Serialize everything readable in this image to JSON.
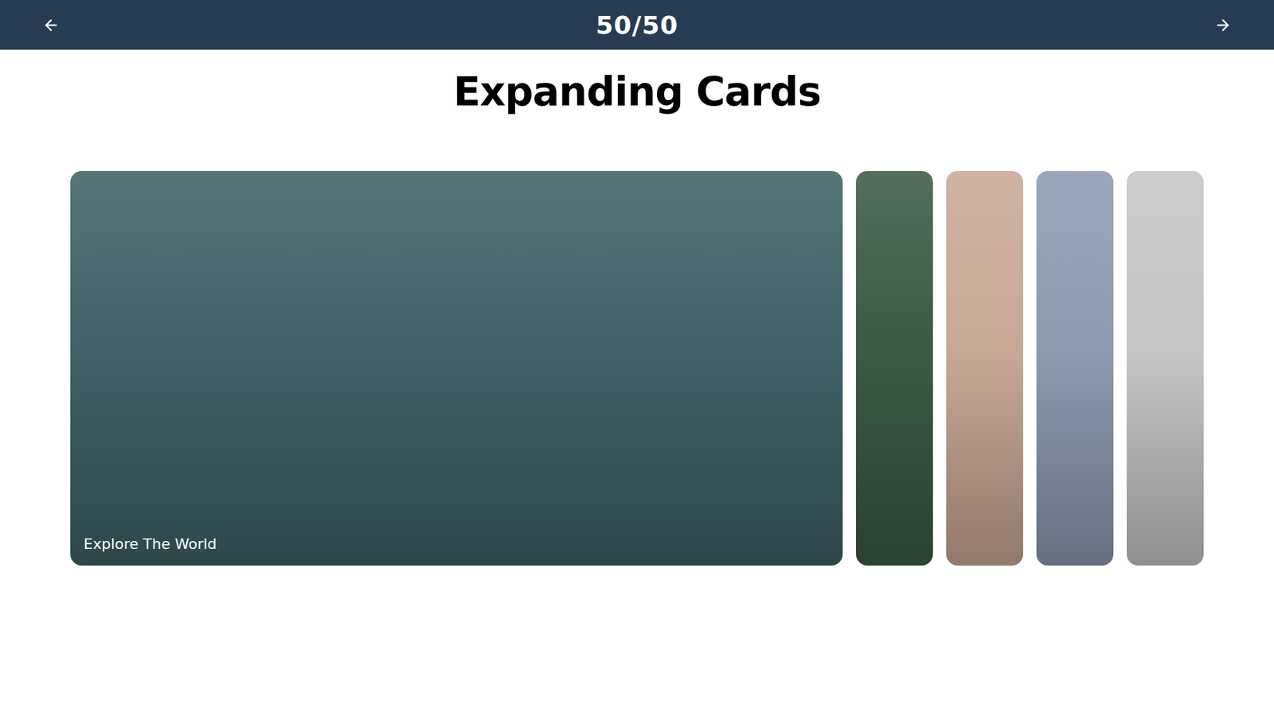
{
  "header": {
    "counter": "50/50"
  },
  "title": "Expanding Cards",
  "cards": [
    {
      "title": "Explore The World",
      "selected": true,
      "color": "#3f6266"
    },
    {
      "selected": false,
      "color": "#3c5a44"
    },
    {
      "selected": false,
      "color": "#c9a896"
    },
    {
      "selected": false,
      "color": "#8d9bb0"
    },
    {
      "selected": false,
      "color": "#c6c6c4"
    }
  ]
}
